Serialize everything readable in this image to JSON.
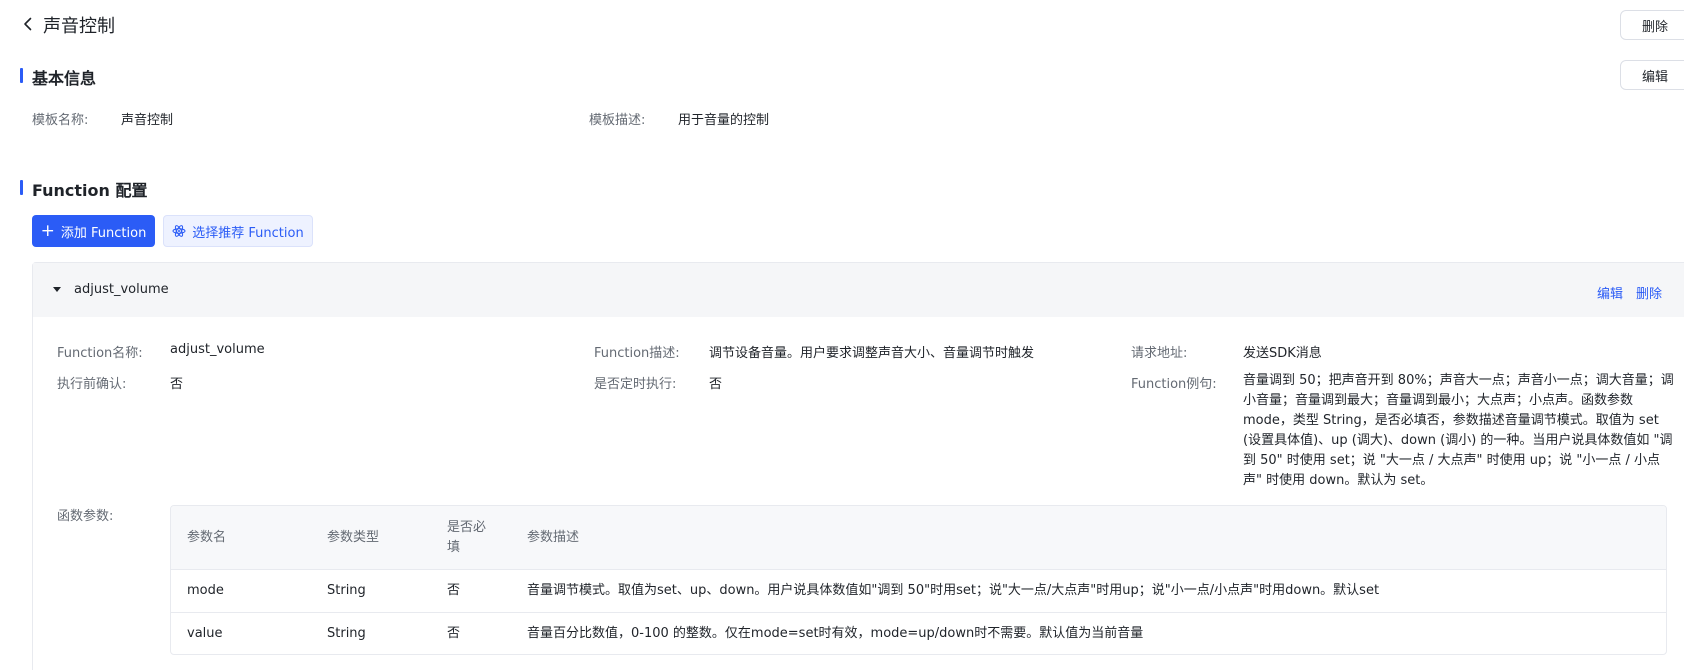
{
  "header": {
    "title": "声音控制",
    "delete_label": "删除"
  },
  "basic_info": {
    "section_title": "基本信息",
    "edit_label": "编辑",
    "template_name_label": "模板名称:",
    "template_name_value": "声音控制",
    "template_desc_label": "模板描述:",
    "template_desc_value": "用于音量的控制"
  },
  "function_config": {
    "section_title": "Function 配置",
    "add_button_label": "添加 Function",
    "recommend_button_label": "选择推荐 Function",
    "card": {
      "name": "adjust_volume",
      "edit_label": "编辑",
      "delete_label": "删除",
      "fields": {
        "function_name_label": "Function名称:",
        "function_name_value": "adjust_volume",
        "function_desc_label": "Function描述:",
        "function_desc_value": "调节设备音量。用户要求调整声音大小、音量调节时触发",
        "request_url_label": "请求地址:",
        "request_url_value": "发送SDK消息",
        "confirm_label": "执行前确认:",
        "confirm_value": "否",
        "scheduled_label": "是否定时执行:",
        "scheduled_value": "否",
        "example_label": "Function例句:",
        "example_value": "音量调到 50；把声音开到 80%；声音大一点；声音小一点；调大音量；调小音量；音量调到最大；音量调到最小；大点声；小点声。函数参数mode，类型 String，是否必填否，参数描述音量调节模式。取值为 set (设置具体值)、up (调大)、down (调小) 的一种。当用户说具体数值如 \"调到 50\" 时使用 set；说 \"大一点 / 大点声\" 时使用 up；说 \"小一点 / 小点声\" 时使用 down。默认为 set。",
        "params_label": "函数参数:"
      },
      "params_table": {
        "columns": [
          "参数名",
          "参数类型",
          "是否必填",
          "参数描述"
        ],
        "rows": [
          {
            "name": "mode",
            "type": "String",
            "required": "否",
            "desc": "音量调节模式。取值为set、up、down。用户说具体数值如\"调到 50\"时用set；说\"大一点/大点声\"时用up；说\"小一点/小点声\"时用down。默认set"
          },
          {
            "name": "value",
            "type": "String",
            "required": "否",
            "desc": "音量百分比数值，0-100 的整数。仅在mode=set时有效，mode=up/down时不需要。默认值为当前音量"
          }
        ]
      }
    }
  },
  "colors": {
    "accent": "#2b5cf6",
    "label": "#646a73",
    "text": "#1f2329"
  }
}
